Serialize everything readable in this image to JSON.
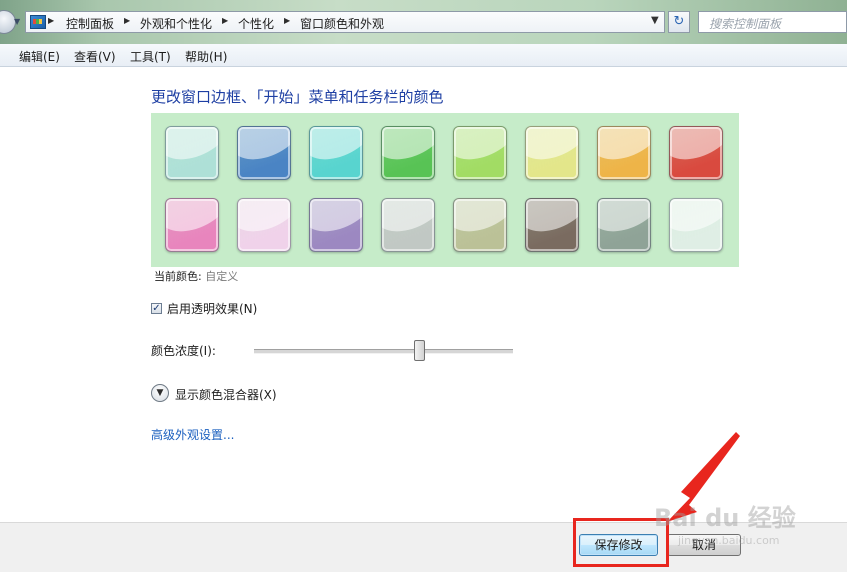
{
  "address_bar": {
    "crumbs": [
      "控制面板",
      "外观和个性化",
      "个性化",
      "窗口颜色和外观"
    ],
    "search_placeholder": "搜索控制面板"
  },
  "menu": {
    "items": [
      "编辑(E)",
      "查看(V)",
      "工具(T)",
      "帮助(H)"
    ]
  },
  "main": {
    "title": "更改窗口边框、「开始」菜单和任务栏的颜色",
    "swatches": [
      "#aee0d7",
      "#4a84c4",
      "#58d4cf",
      "#58c355",
      "#a2dc64",
      "#e3e68a",
      "#eeb448",
      "#d94a3f",
      "#e885bd",
      "#f0d2ea",
      "#9c88c1",
      "#c1c8c4",
      "#bbc197",
      "#7a6b60",
      "#8fa397",
      "#dfeee5"
    ],
    "current_color_label": "当前颜色:",
    "current_color_value": "自定义",
    "transparency": {
      "label": "启用透明效果(N)",
      "checked": true
    },
    "intensity": {
      "label": "颜色浓度(I):",
      "value": 0.64
    },
    "mixer_label": "显示颜色混合器(X)",
    "advanced_link": "高级外观设置..."
  },
  "footer": {
    "save_label": "保存修改",
    "cancel_label": "取消"
  },
  "watermark": {
    "main": "Bai du 经验",
    "sub": "jingyan.baidu.com"
  },
  "colors": {
    "highlight": "#e8261e",
    "link": "#1a5fbf",
    "title": "#1e3fa3",
    "palette_bg": "#c6ecc9"
  }
}
